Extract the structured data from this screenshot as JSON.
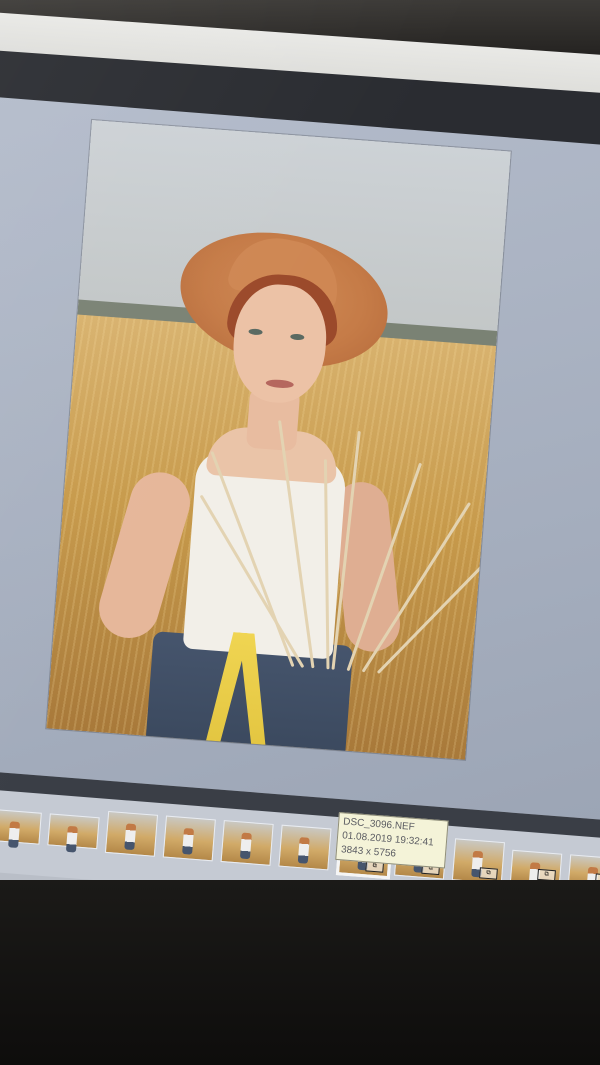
{
  "photo": {
    "subject": "woman-in-straw-hat-holding-wheat"
  },
  "filmstrip": {
    "thumbnails": [
      {
        "orientation": "landscape",
        "selected": false
      },
      {
        "orientation": "landscape",
        "selected": false
      },
      {
        "orientation": "portrait",
        "selected": false
      },
      {
        "orientation": "portrait",
        "selected": false
      },
      {
        "orientation": "portrait",
        "selected": false
      },
      {
        "orientation": "portrait",
        "selected": false
      },
      {
        "orientation": "portrait",
        "selected": true
      },
      {
        "orientation": "portrait",
        "selected": false
      },
      {
        "orientation": "portrait",
        "selected": false
      },
      {
        "orientation": "landscape",
        "selected": false
      },
      {
        "orientation": "landscape",
        "selected": false
      }
    ],
    "scroll_icon": "triangle-down-icon"
  },
  "tooltip": {
    "filename": "DSC_3096.NEF",
    "datetime": "01.08.2019 19:32:41",
    "dimensions": "3843 x 5756"
  },
  "colors": {
    "panel_background": "#a3acbc",
    "tooltip_background": "#f4f3d8",
    "filmstrip_background": "#c5cad3"
  }
}
